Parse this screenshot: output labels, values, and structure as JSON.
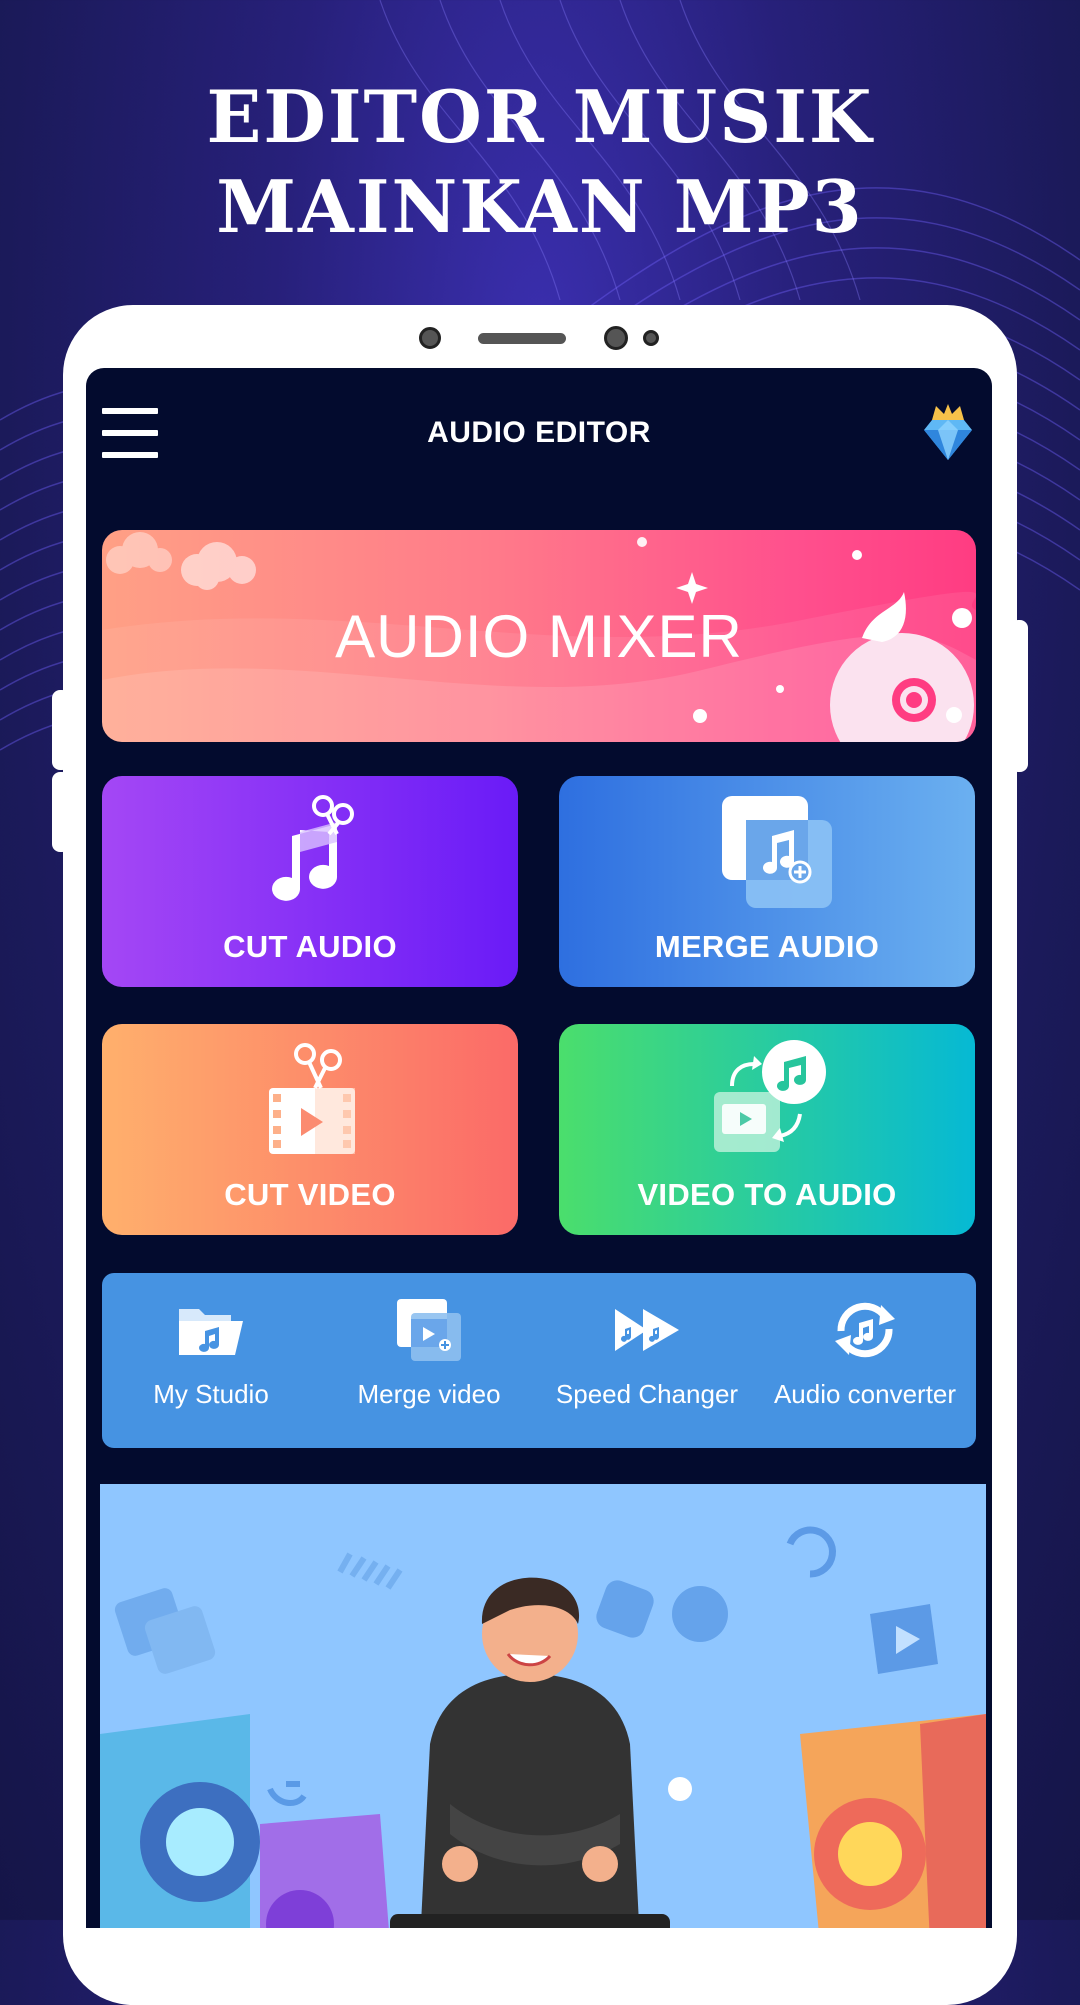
{
  "promo": {
    "title_line1": "EDITOR MUSIK",
    "title_line2": "MAINKAN MP3"
  },
  "app": {
    "title": "AUDIO EDITOR",
    "menu_icon": "hamburger-menu-icon",
    "premium_icon": "crown-diamond-icon"
  },
  "banner": {
    "label": "AUDIO MIXER"
  },
  "tiles": [
    {
      "label": "CUT AUDIO",
      "icon": "music-scissors-icon"
    },
    {
      "label": "MERGE AUDIO",
      "icon": "music-merge-icon"
    },
    {
      "label": "CUT VIDEO",
      "icon": "video-scissors-icon"
    },
    {
      "label": "VIDEO TO AUDIO",
      "icon": "video-convert-audio-icon"
    }
  ],
  "tools": [
    {
      "label": "My Studio",
      "icon": "music-folder-icon"
    },
    {
      "label": "Merge video",
      "icon": "video-merge-icon"
    },
    {
      "label": "Speed Changer",
      "icon": "fast-forward-icon"
    },
    {
      "label": "Audio converter",
      "icon": "sync-music-icon"
    }
  ],
  "colors": {
    "background": "#1b1a5a",
    "screen": "#030b2e",
    "tools_bar": "#4693e2",
    "illustration_bg": "#8fc6ff"
  }
}
